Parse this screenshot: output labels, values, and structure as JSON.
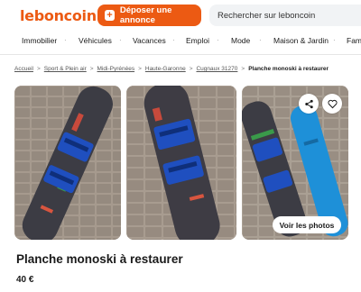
{
  "header": {
    "logo": "leboncoin",
    "post_button": "Déposer une annonce",
    "search_placeholder": "Rechercher sur leboncoin"
  },
  "nav": {
    "items": [
      "Immobilier",
      "Véhicules",
      "Vacances",
      "Emploi",
      "Mode",
      "Maison & Jardin",
      "Fami"
    ]
  },
  "breadcrumb": {
    "items": [
      "Accueil",
      "Sport & Plein air",
      "Midi-Pyrénées",
      "Haute-Garonne",
      "Cugnaux 31270"
    ],
    "current": "Planche monoski à restaurer"
  },
  "gallery": {
    "see_photos_label": "Voir les photos",
    "icons": [
      "share-icon",
      "heart-icon"
    ]
  },
  "ad": {
    "title": "Planche monoski à restaurer",
    "price": "40 €"
  },
  "colors": {
    "brand": "#ec5a13",
    "pavement": "#9b8f84",
    "board": "#3c3c44",
    "bindings": "#1f4fbf",
    "blue_board": "#1e90d8"
  }
}
